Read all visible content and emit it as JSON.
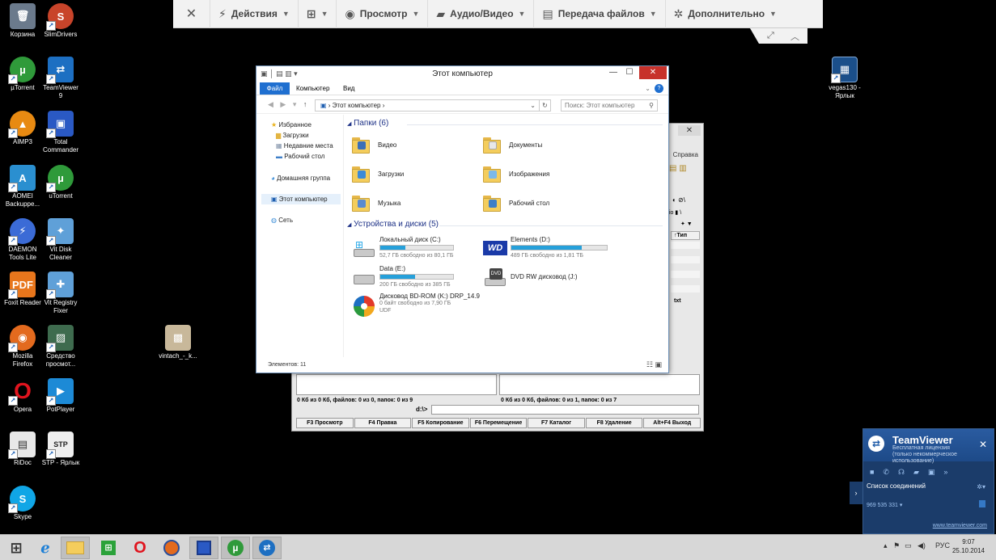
{
  "toolbar": {
    "close_glyph": "✕",
    "actions": "Действия",
    "view": "Просмотр",
    "audio_video": "Аудио/Видео",
    "file_transfer": "Передача файлов",
    "extra": "Дополнительно"
  },
  "desktop_icons": {
    "recycle": "Корзина",
    "slimdrivers": "SlimDrivers",
    "utorrent": "µTorrent",
    "teamviewer": "TeamViewer\n9",
    "aimp": "AIMP3",
    "totalcmd": "Total\nCommander",
    "aomei": "AOMEI\nBackuppe...",
    "utorrent2": "uTorrent",
    "daemon": "DAEMON\nTools Lite",
    "vitdisk": "Vit Disk\nCleaner",
    "foxit": "Foxit Reader",
    "vitreg": "Vit Registry\nFixer",
    "firefox": "Mozilla\nFirefox",
    "sredstvo": "Средство\nпросмот...",
    "vintach": "vintach_-_k...",
    "opera": "Opera",
    "potplayer": "PotPlayer",
    "ridoc": "RiDoc",
    "stp": "STP - Ярлык",
    "skype": "Skype",
    "vegas": "vegas130 -\nЯрлык"
  },
  "explorer": {
    "title": "Этот компьютер",
    "ribbon": {
      "file": "Файл",
      "computer": "Компьютер",
      "view": "Вид"
    },
    "address": "Этот компьютер",
    "search_placeholder": "Поиск: Этот компьютер",
    "nav": {
      "favorites": "Избранное",
      "downloads": "Загрузки",
      "recent": "Недавние места",
      "desktop": "Рабочий стол",
      "homegroup": "Домашняя группа",
      "this_pc": "Этот компьютер",
      "network": "Сеть"
    },
    "folders_header": "Папки (6)",
    "folders": [
      "Видео",
      "Документы",
      "Загрузки",
      "Изображения",
      "Музыка",
      "Рабочий стол"
    ],
    "devices_header": "Устройства и диски (5)",
    "drives": [
      {
        "name": "Локальный диск (C:)",
        "info": "52,7 ГБ свободно из 80,1 ГБ",
        "used_fraction": 0.34
      },
      {
        "name": "Elements (D:)",
        "info": "489 ГБ свободно из 1,81 ТБ",
        "used_fraction": 0.74
      },
      {
        "name": "Data (E:)",
        "info": "200 ГБ свободно из 385 ГБ",
        "used_fraction": 0.48
      },
      {
        "name": "DVD RW дисковод (J:)",
        "info": "",
        "used_fraction": null
      },
      {
        "name": "Дисковод BD-ROM (K:) DRP_14.9",
        "info": "0 байт свободно из 7,90 ГБ",
        "extra": "UDF",
        "used_fraction": null
      }
    ],
    "status": "Элементов: 11"
  },
  "totalcmd": {
    "menu_help": "Справка",
    "col_type": "↑Тип",
    "txt_label": "txt",
    "status_left": "0 Кб из 0 Кб, файлов: 0 из 0, папок: 0 из 9",
    "status_right": "0 Кб из 0 Кб, файлов: 0 из 1, папок: 0 из 7",
    "cmd_prompt": "d:\\>",
    "fkeys": [
      "F3 Просмотр",
      "F4 Правка",
      "F5 Копирование",
      "F6 Перемещение",
      "F7 Каталог",
      "F8 Удаление",
      "Alt+F4 Выход"
    ]
  },
  "teamviewer_panel": {
    "title": "TeamViewer",
    "license": "Бесплатная лицензия\n(только некоммерческое\nиспользование)",
    "connections": "Список соединений",
    "session_id": "969 535 331",
    "site": "www.teamviewer.com"
  },
  "taskbar": {
    "lang": "РУС",
    "time": "9:07",
    "date": "25.10.2014"
  }
}
